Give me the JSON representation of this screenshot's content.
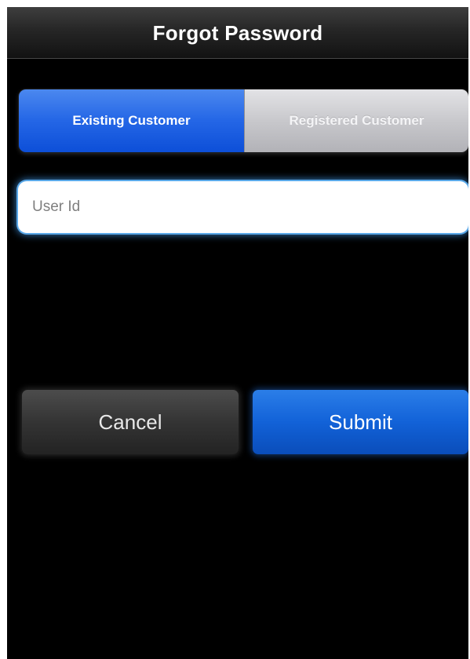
{
  "navbar": {
    "title": "Forgot Password"
  },
  "segmented_control": {
    "options": [
      {
        "label": "Existing Customer",
        "selected": true
      },
      {
        "label": "Registered Customer",
        "selected": false
      }
    ]
  },
  "user_id_field": {
    "placeholder": "User Id",
    "value": ""
  },
  "actions": {
    "cancel_label": "Cancel",
    "submit_label": "Submit"
  },
  "colors": {
    "background": "#000000",
    "accent_blue": "#1262d8",
    "segment_selected": "#2466e6",
    "segment_unselected": "#c8c8cc",
    "focus_glow": "#5aa8e8"
  }
}
